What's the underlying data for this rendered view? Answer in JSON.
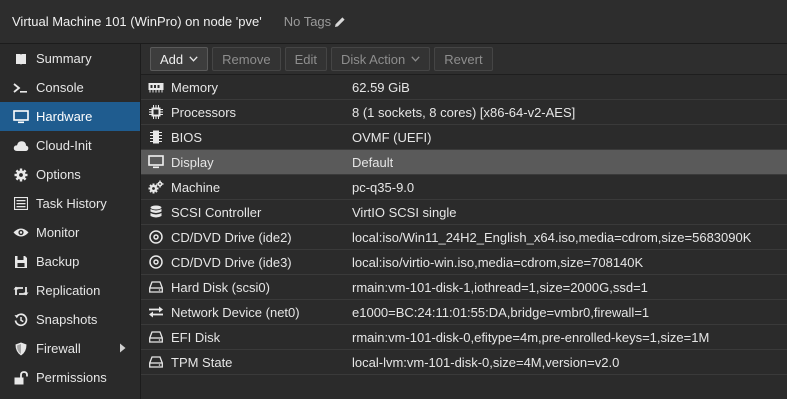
{
  "title": {
    "vm_title": "Virtual Machine 101 (WinPro) on node 'pve'",
    "tags_label": "No Tags",
    "tags_icon": "pencil-icon"
  },
  "sidebar": {
    "items": [
      {
        "label": "Summary",
        "icon": "book-icon"
      },
      {
        "label": "Console",
        "icon": "terminal-icon"
      },
      {
        "label": "Hardware",
        "icon": "monitor-icon",
        "active": true
      },
      {
        "label": "Cloud-Init",
        "icon": "cloud-icon"
      },
      {
        "label": "Options",
        "icon": "gear-icon"
      },
      {
        "label": "Task History",
        "icon": "list-icon"
      },
      {
        "label": "Monitor",
        "icon": "eye-icon"
      },
      {
        "label": "Backup",
        "icon": "floppy-icon"
      },
      {
        "label": "Replication",
        "icon": "retweet-icon"
      },
      {
        "label": "Snapshots",
        "icon": "history-icon"
      },
      {
        "label": "Firewall",
        "icon": "shield-icon",
        "expandable": true
      },
      {
        "label": "Permissions",
        "icon": "unlock-icon"
      }
    ]
  },
  "toolbar": {
    "add_label": "Add",
    "remove_label": "Remove",
    "edit_label": "Edit",
    "disk_action_label": "Disk Action",
    "revert_label": "Revert"
  },
  "hardware": [
    {
      "icon": "memory-icon",
      "name": "Memory",
      "value": "62.59 GiB"
    },
    {
      "icon": "cpu-icon",
      "name": "Processors",
      "value": "8 (1 sockets, 8 cores) [x86-64-v2-AES]"
    },
    {
      "icon": "chip-icon",
      "name": "BIOS",
      "value": "OVMF (UEFI)"
    },
    {
      "icon": "desktop-icon",
      "name": "Display",
      "value": "Default",
      "selected": true
    },
    {
      "icon": "cogs-icon",
      "name": "Machine",
      "value": "pc-q35-9.0"
    },
    {
      "icon": "database-icon",
      "name": "SCSI Controller",
      "value": "VirtIO SCSI single"
    },
    {
      "icon": "cdrom-icon",
      "name": "CD/DVD Drive (ide2)",
      "value": "local:iso/Win11_24H2_English_x64.iso,media=cdrom,size=5683090K"
    },
    {
      "icon": "cdrom-icon",
      "name": "CD/DVD Drive (ide3)",
      "value": "local:iso/virtio-win.iso,media=cdrom,size=708140K"
    },
    {
      "icon": "hdd-icon",
      "name": "Hard Disk (scsi0)",
      "value": "rmain:vm-101-disk-1,iothread=1,size=2000G,ssd=1"
    },
    {
      "icon": "exchange-icon",
      "name": "Network Device (net0)",
      "value": "e1000=BC:24:11:01:55:DA,bridge=vmbr0,firewall=1"
    },
    {
      "icon": "hdd-icon",
      "name": "EFI Disk",
      "value": "rmain:vm-101-disk-0,efitype=4m,pre-enrolled-keys=1,size=1M"
    },
    {
      "icon": "hdd-icon",
      "name": "TPM State",
      "value": "local-lvm:vm-101-disk-0,size=4M,version=v2.0"
    }
  ],
  "colors": {
    "active_nav": "#1f5c8f",
    "selected_row": "#5a5a5a",
    "background": "#2b2b2b"
  }
}
